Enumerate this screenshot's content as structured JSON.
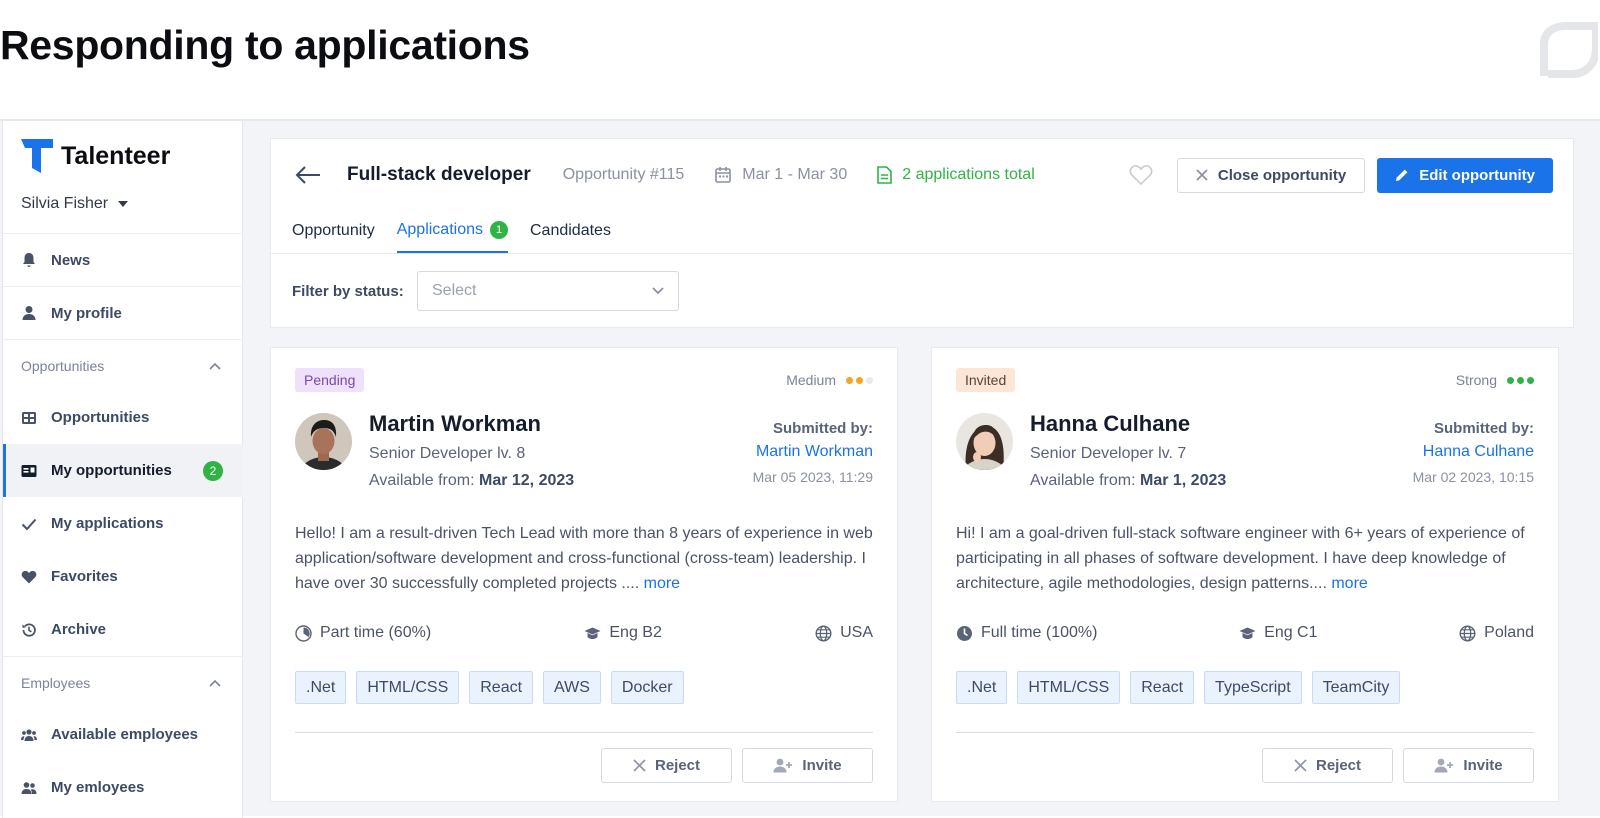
{
  "headline": "Responding to applications",
  "colors": {
    "accent": "#1a73e8",
    "success": "#2fb344",
    "medium": "#f4a521",
    "pending_bg": "#efe0fb",
    "invited_bg": "#fde6d6"
  },
  "sidebar": {
    "brand": "Talenteer",
    "user": "Silvia Fisher",
    "items": [
      {
        "label": "News",
        "icon": "bell-icon"
      },
      {
        "label": "My profile",
        "icon": "user-icon"
      }
    ],
    "sections": [
      {
        "title": "Opportunities",
        "items": [
          {
            "label": "Opportunities",
            "icon": "grid-icon"
          },
          {
            "label": "My opportunities",
            "icon": "id-card-icon",
            "badge": "2",
            "active": true
          },
          {
            "label": "My applications",
            "icon": "check-icon"
          },
          {
            "label": "Favorites",
            "icon": "heart-icon"
          },
          {
            "label": "Archive",
            "icon": "history-icon"
          }
        ]
      },
      {
        "title": "Employees",
        "items": [
          {
            "label": "Available employees",
            "icon": "users-icon"
          },
          {
            "label": "My emloyees",
            "icon": "user-group-icon"
          }
        ]
      }
    ]
  },
  "header": {
    "title": "Full-stack developer",
    "opportunity_number": "Opportunity #115",
    "dates": "Mar 1 - Mar 30",
    "applications_total": "2 applications total",
    "close_label": "Close opportunity",
    "edit_label": "Edit opportunity",
    "tabs": [
      {
        "label": "Opportunity"
      },
      {
        "label": "Applications",
        "badge": "1",
        "active": true
      },
      {
        "label": "Candidates"
      }
    ],
    "filter_label": "Filter by status:",
    "filter_placeholder": "Select"
  },
  "cards": [
    {
      "status": "Pending",
      "match_label": "Medium",
      "match_level": 2,
      "name": "Martin Workman",
      "role": "Senior Developer lv. 8",
      "available_prefix": "Available from:",
      "available_date": "Mar 12, 2023",
      "submitted_label": "Submitted by:",
      "submitted_by": "Martin Workman",
      "submitted_at": "Mar 05 2023, 11:29",
      "bio": "Hello! I am a result-driven Tech Lead with more than 8 years of experience in web application/software development and cross-functional (cross-team) leadership. I have over 30 successfully completed projects ....",
      "more": "more",
      "employment": "Part time (60%)",
      "english": "Eng B2",
      "country": "USA",
      "skills": [
        ".Net",
        "HTML/CSS",
        "React",
        "AWS",
        "Docker"
      ],
      "reject_label": "Reject",
      "invite_label": "Invite"
    },
    {
      "status": "Invited",
      "match_label": "Strong",
      "match_level": 3,
      "name": "Hanna Culhane",
      "role": "Senior Developer lv. 7",
      "available_prefix": "Available from:",
      "available_date": "Mar 1, 2023",
      "submitted_label": "Submitted by:",
      "submitted_by": "Hanna Culhane",
      "submitted_at": "Mar 02 2023, 10:15",
      "bio": "Hi! I am a goal-driven full-stack software engineer with 6+ years of experience of participating in all phases of software development. I have deep knowledge of architecture, agile methodologies, design patterns....",
      "more": "more",
      "employment": "Full time (100%)",
      "english": "Eng C1",
      "country": "Poland",
      "skills": [
        ".Net",
        "HTML/CSS",
        "React",
        "TypeScript",
        "TeamCity"
      ],
      "reject_label": "Reject",
      "invite_label": "Invite"
    }
  ]
}
